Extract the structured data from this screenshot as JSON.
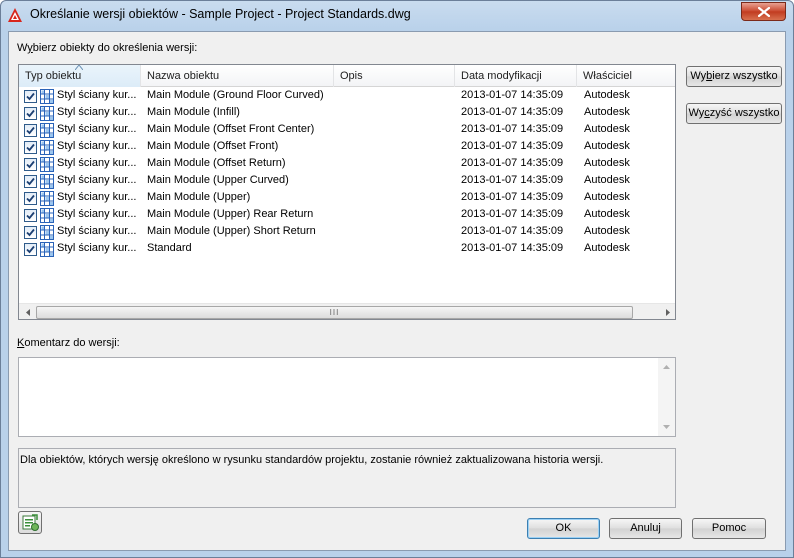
{
  "window": {
    "title": "Określanie wersji obiektów - Sample Project - Project Standards.dwg",
    "close_icon": "close-icon",
    "app_icon": "autocad-logo-icon"
  },
  "select_label_pre": "W",
  "select_label_u": "y",
  "select_label_post": "bierz obiekty do określenia wersji:",
  "columns": [
    {
      "label": "Typ obiektu"
    },
    {
      "label": "Nazwa obiektu"
    },
    {
      "label": "Opis"
    },
    {
      "label": "Data modyfikacji"
    },
    {
      "label": "Właściciel"
    }
  ],
  "rows": [
    {
      "type": "Styl ściany kur...",
      "name": "Main Module (Ground Floor Curved)",
      "desc": "",
      "date": "2013-01-07 14:35:09",
      "owner": "Autodesk",
      "checked": true
    },
    {
      "type": "Styl ściany kur...",
      "name": "Main Module (Infill)",
      "desc": "",
      "date": "2013-01-07 14:35:09",
      "owner": "Autodesk",
      "checked": true
    },
    {
      "type": "Styl ściany kur...",
      "name": "Main Module (Offset Front Center)",
      "desc": "",
      "date": "2013-01-07 14:35:09",
      "owner": "Autodesk",
      "checked": true
    },
    {
      "type": "Styl ściany kur...",
      "name": "Main Module (Offset Front)",
      "desc": "",
      "date": "2013-01-07 14:35:09",
      "owner": "Autodesk",
      "checked": true
    },
    {
      "type": "Styl ściany kur...",
      "name": "Main Module (Offset Return)",
      "desc": "",
      "date": "2013-01-07 14:35:09",
      "owner": "Autodesk",
      "checked": true
    },
    {
      "type": "Styl ściany kur...",
      "name": "Main Module (Upper Curved)",
      "desc": "",
      "date": "2013-01-07 14:35:09",
      "owner": "Autodesk",
      "checked": true
    },
    {
      "type": "Styl ściany kur...",
      "name": "Main Module (Upper)",
      "desc": "",
      "date": "2013-01-07 14:35:09",
      "owner": "Autodesk",
      "checked": true
    },
    {
      "type": "Styl ściany kur...",
      "name": "Main Module (Upper) Rear Return",
      "desc": "",
      "date": "2013-01-07 14:35:09",
      "owner": "Autodesk",
      "checked": true
    },
    {
      "type": "Styl ściany kur...",
      "name": "Main Module (Upper) Short Return",
      "desc": "",
      "date": "2013-01-07 14:35:09",
      "owner": "Autodesk",
      "checked": true
    },
    {
      "type": "Styl ściany kur...",
      "name": "Standard",
      "desc": "",
      "date": "2013-01-07 14:35:09",
      "owner": "Autodesk",
      "checked": true
    }
  ],
  "scroll_thumb_grip": "III",
  "buttons": {
    "select_all_pre": "Wy",
    "select_all_u": "b",
    "select_all_post": "ierz wszystko",
    "clear_all_pre": "Wy",
    "clear_all_u": "c",
    "clear_all_post": "zyść wszystko",
    "ok": "OK",
    "cancel": "Anuluj",
    "help": "Pomoc"
  },
  "comment_label_u": "K",
  "comment_label_post": "omentarz do wersji:",
  "comment_value": "",
  "info_text": "Dla obiektów, których wersję określono w rysunku standardów projektu, zostanie również zaktualizowana historia wersji."
}
